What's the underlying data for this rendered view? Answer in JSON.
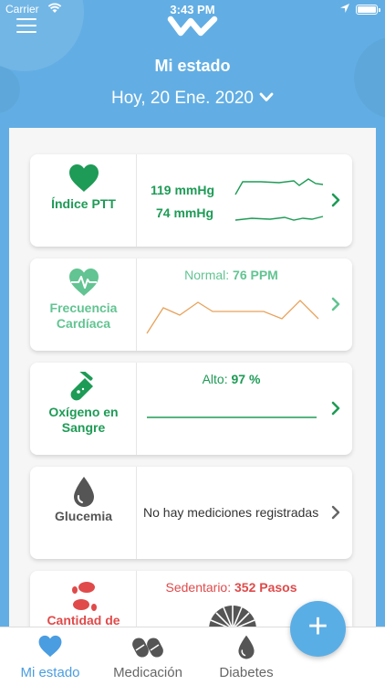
{
  "status_bar": {
    "carrier": "Carrier",
    "time": "3:43 PM"
  },
  "header": {
    "title": "Mi estado",
    "date": "Hoy, 20 Ene. 2020"
  },
  "cards": {
    "ptt": {
      "label": "Índice PTT",
      "systolic": "119 mmHg",
      "diastolic": "74 mmHg",
      "color": "#1e9b56"
    },
    "heart": {
      "label_line1": "Frecuencia",
      "label_line2": "Cardíaca",
      "status": "Normal:",
      "value": "76 PPM",
      "color": "#62c492",
      "chart_color": "#e8a25b"
    },
    "oxygen": {
      "label_line1": "Oxígeno en",
      "label_line2": "Sangre",
      "status": "Alto:",
      "value": "97 %",
      "color": "#1e9b56"
    },
    "glucose": {
      "label": "Glucemia",
      "message": "No hay mediciones registradas"
    },
    "steps": {
      "label": "Cantidad de",
      "status": "Sedentario:",
      "value": "352 Pasos",
      "color": "#e04a4a"
    }
  },
  "tabs": [
    {
      "label": "Mi estado",
      "icon": "heart-icon",
      "active": true
    },
    {
      "label": "Medicación",
      "icon": "pills-icon",
      "active": false
    },
    {
      "label": "Diabetes",
      "icon": "drop-icon",
      "active": false
    }
  ],
  "fab": {
    "label": "+"
  },
  "colors": {
    "primary": "#62aee4",
    "background": "#f6f6f6"
  }
}
